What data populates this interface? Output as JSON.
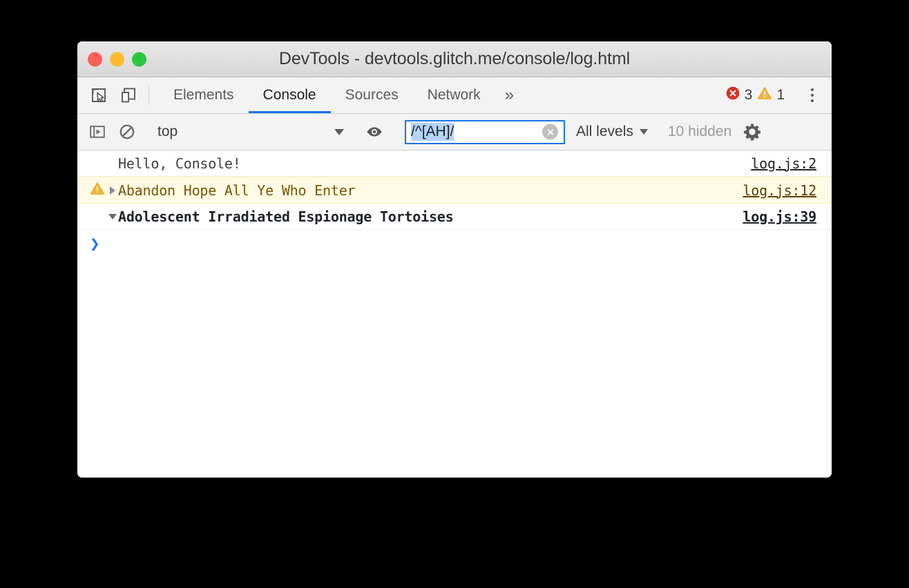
{
  "window": {
    "title": "DevTools - devtools.glitch.me/console/log.html",
    "traffic_lights": [
      "close-button",
      "minimize-button",
      "maximize-button"
    ]
  },
  "tabbar": {
    "left_icons": [
      {
        "name": "inspect-element-icon",
        "label": "Inspect element"
      },
      {
        "name": "device-toolbar-icon",
        "label": "Toggle device toolbar"
      }
    ],
    "tabs": [
      {
        "label": "Elements",
        "active": false
      },
      {
        "label": "Console",
        "active": true
      },
      {
        "label": "Sources",
        "active": false
      },
      {
        "label": "Network",
        "active": false
      }
    ],
    "more_tabs_label": "»",
    "error_count": "3",
    "warning_count": "1",
    "main_menu_label": "Customize and control DevTools"
  },
  "console_toolbar": {
    "sidebar_toggle_label": "Show console sidebar",
    "clear_console_label": "Clear console",
    "context": {
      "value": "top",
      "placeholder": "top"
    },
    "live_expression_label": "Create live expression",
    "filter": {
      "value": "/^[AH]/",
      "placeholder": "Filter",
      "selected": true,
      "clear_label": "Clear input"
    },
    "levels": {
      "value": "All levels"
    },
    "hidden_count": "10 hidden",
    "settings_label": "Console settings"
  },
  "messages": [
    {
      "kind": "log",
      "gutter": "",
      "expander": "",
      "text": "Hello, Console!",
      "source": "log.js:2"
    },
    {
      "kind": "warning",
      "gutter": "warning-icon",
      "expander": "collapsed",
      "text": "Abandon Hope All Ye Who Enter",
      "source": "log.js:12"
    },
    {
      "kind": "group",
      "gutter": "",
      "expander": "expanded",
      "text": "Adolescent Irradiated Espionage Tortoises",
      "source": "log.js:39"
    }
  ],
  "prompt": {
    "chevron": "❯",
    "value": "",
    "placeholder": ""
  },
  "colors": {
    "accent": "#1a73e8",
    "error": "#d93025",
    "warning": "#f2b53d",
    "warning_row_bg": "#fffbe5",
    "selection": "#b3d4fc"
  }
}
